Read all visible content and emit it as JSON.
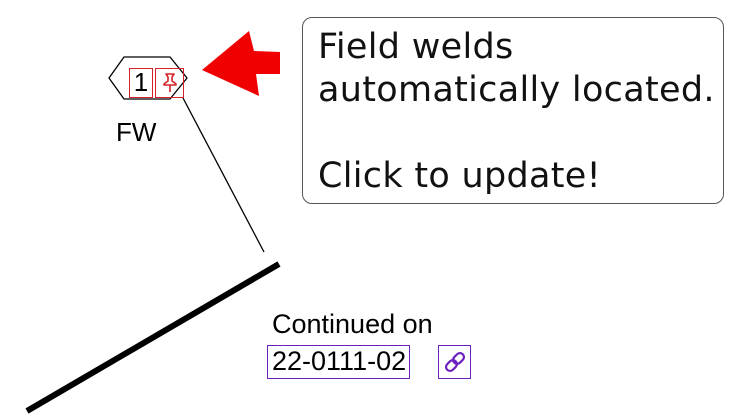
{
  "weld_tag": {
    "number": "1",
    "label": "FW",
    "icon": "pushpin-icon"
  },
  "callout": {
    "line1": "Field welds",
    "line2": "automatically located.",
    "line3": "Click to update!"
  },
  "continuation": {
    "label": "Continued on",
    "drawing": "22-0111-02",
    "icon": "link-icon"
  },
  "colors": {
    "arrow": "#f00000",
    "tag_border": "#d6202a",
    "link_border": "#6a1fbf"
  }
}
